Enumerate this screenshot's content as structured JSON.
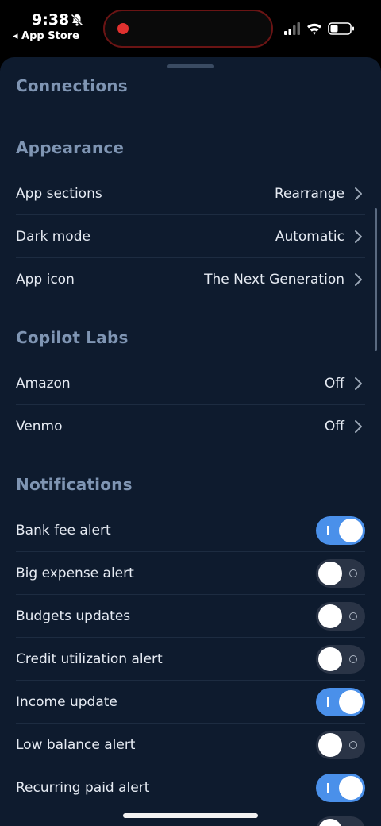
{
  "status_bar": {
    "time": "9:38",
    "back_label": "◂ App Store"
  },
  "sections": {
    "connections": "Connections",
    "appearance": "Appearance",
    "labs": "Copilot Labs",
    "notifications": "Notifications"
  },
  "appearance_rows": [
    {
      "label": "App sections",
      "value": "Rearrange"
    },
    {
      "label": "Dark mode",
      "value": "Automatic"
    },
    {
      "label": "App icon",
      "value": "The Next Generation"
    }
  ],
  "labs_rows": [
    {
      "label": "Amazon",
      "value": "Off"
    },
    {
      "label": "Venmo",
      "value": "Off"
    }
  ],
  "notification_rows": [
    {
      "label": "Bank fee alert",
      "on": true
    },
    {
      "label": "Big expense alert",
      "on": false
    },
    {
      "label": "Budgets updates",
      "on": false
    },
    {
      "label": "Credit utilization alert",
      "on": false
    },
    {
      "label": "Income update",
      "on": true
    },
    {
      "label": "Low balance alert",
      "on": false
    },
    {
      "label": "Recurring paid alert",
      "on": true
    },
    {
      "label": "",
      "on": false
    }
  ],
  "colors": {
    "sheet_bg": "#0e1b2e",
    "section_header": "#7f95b3",
    "toggle_on": "#4a90ea",
    "toggle_off": "#2a3446",
    "recording_dot": "#e0312f"
  },
  "icons": {
    "bell": "bell-slash-icon",
    "signal": "cellular-signal-icon",
    "wifi": "wifi-icon",
    "battery": "battery-icon",
    "chevron": "chevron-right-icon"
  }
}
